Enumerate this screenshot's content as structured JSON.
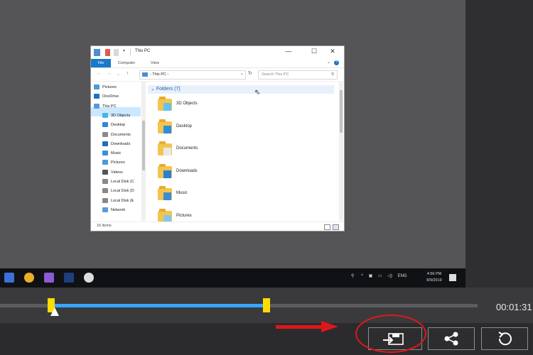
{
  "explorer": {
    "title": "This PC",
    "tabs": [
      "File",
      "Computer",
      "View"
    ],
    "help_glyph": "?",
    "address": "This PC",
    "search_placeholder": "Search This PC",
    "nav_items": [
      {
        "label": "Pictures",
        "color": "#4d9ad6"
      },
      {
        "label": "OneDrive",
        "color": "#1a73c8"
      },
      {
        "label": "This PC",
        "color": "#5a9bd5"
      },
      {
        "label": "3D Objects",
        "color": "#4ab3e2"
      },
      {
        "label": "Desktop",
        "color": "#2f86d8"
      },
      {
        "label": "Documents",
        "color": "#8a8a8a"
      },
      {
        "label": "Downloads",
        "color": "#1f6fbf"
      },
      {
        "label": "Music",
        "color": "#3a8fd8"
      },
      {
        "label": "Pictures",
        "color": "#4d9ad6"
      },
      {
        "label": "Videos",
        "color": "#555555"
      },
      {
        "label": "Local Disk (C",
        "color": "#888888"
      },
      {
        "label": "Local Disk (D",
        "color": "#888888"
      },
      {
        "label": "Local Disk (E",
        "color": "#888888"
      },
      {
        "label": "Network",
        "color": "#5a9bd5"
      }
    ],
    "folders_header": "Folders (7)",
    "folders": [
      {
        "label": "3D Objects",
        "overlay": "#62c2ee"
      },
      {
        "label": "Desktop",
        "overlay": "#2d8ee0"
      },
      {
        "label": "Documents",
        "overlay": "#e9e9e9"
      },
      {
        "label": "Downloads",
        "overlay": "#2d7fd1"
      },
      {
        "label": "Music",
        "overlay": "#3b8dd6"
      },
      {
        "label": "Pictures",
        "overlay": "#86c6ee"
      }
    ],
    "status_text": "16 items"
  },
  "taskbar": {
    "apps": [
      {
        "icon": "photos-app-icon",
        "color": "#3d6fd8"
      },
      {
        "icon": "chrome-icon",
        "color": "#e8b02a"
      },
      {
        "icon": "viber-icon",
        "color": "#8a5bd1"
      },
      {
        "icon": "photoshop-icon",
        "color": "#1f3f7a"
      },
      {
        "icon": "recorder-icon",
        "color": "#dddddd"
      }
    ],
    "language": "ENG",
    "time": "4:56 PM",
    "date": "8/9/2019"
  },
  "timeline": {
    "timecode": "00:01:31",
    "selection_start": 0.107,
    "selection_end": 0.558
  },
  "colors": {
    "accent": "#35a6ff",
    "handle": "#ffdc00",
    "annotation": "#e0161b"
  }
}
